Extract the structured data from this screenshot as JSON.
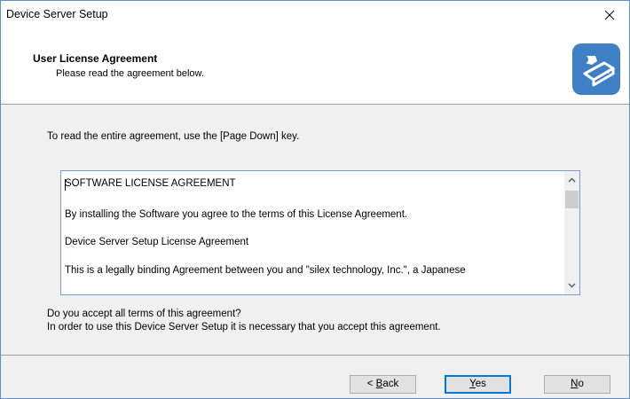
{
  "window": {
    "title": "Device Server Setup"
  },
  "header": {
    "title": "User License Agreement",
    "subtitle": "Please read the agreement below.",
    "icon": "setup-wrench-disk-icon"
  },
  "instruction": "To read the entire agreement, use the [Page Down] key.",
  "license": {
    "lines": [
      "SOFTWARE LICENSE AGREEMENT",
      "By installing the Software you agree to the terms of this License Agreement.",
      "Device Server Setup License Agreement",
      "This is a legally binding Agreement between you and \"silex technology, Inc.\", a Japanese"
    ]
  },
  "question": {
    "line1": "Do you accept all terms of this agreement?",
    "line2": "In order to use this Device Server Setup it is necessary that you accept this agreement."
  },
  "buttons": {
    "back": {
      "prefix": "< ",
      "mnemonic": "B",
      "rest": "ack"
    },
    "yes": {
      "prefix": "",
      "mnemonic": "Y",
      "rest": "es"
    },
    "no": {
      "prefix": "",
      "mnemonic": "N",
      "rest": "o"
    }
  },
  "colors": {
    "accent": "#0078d7",
    "icon_blue": "#3f7fc6"
  }
}
